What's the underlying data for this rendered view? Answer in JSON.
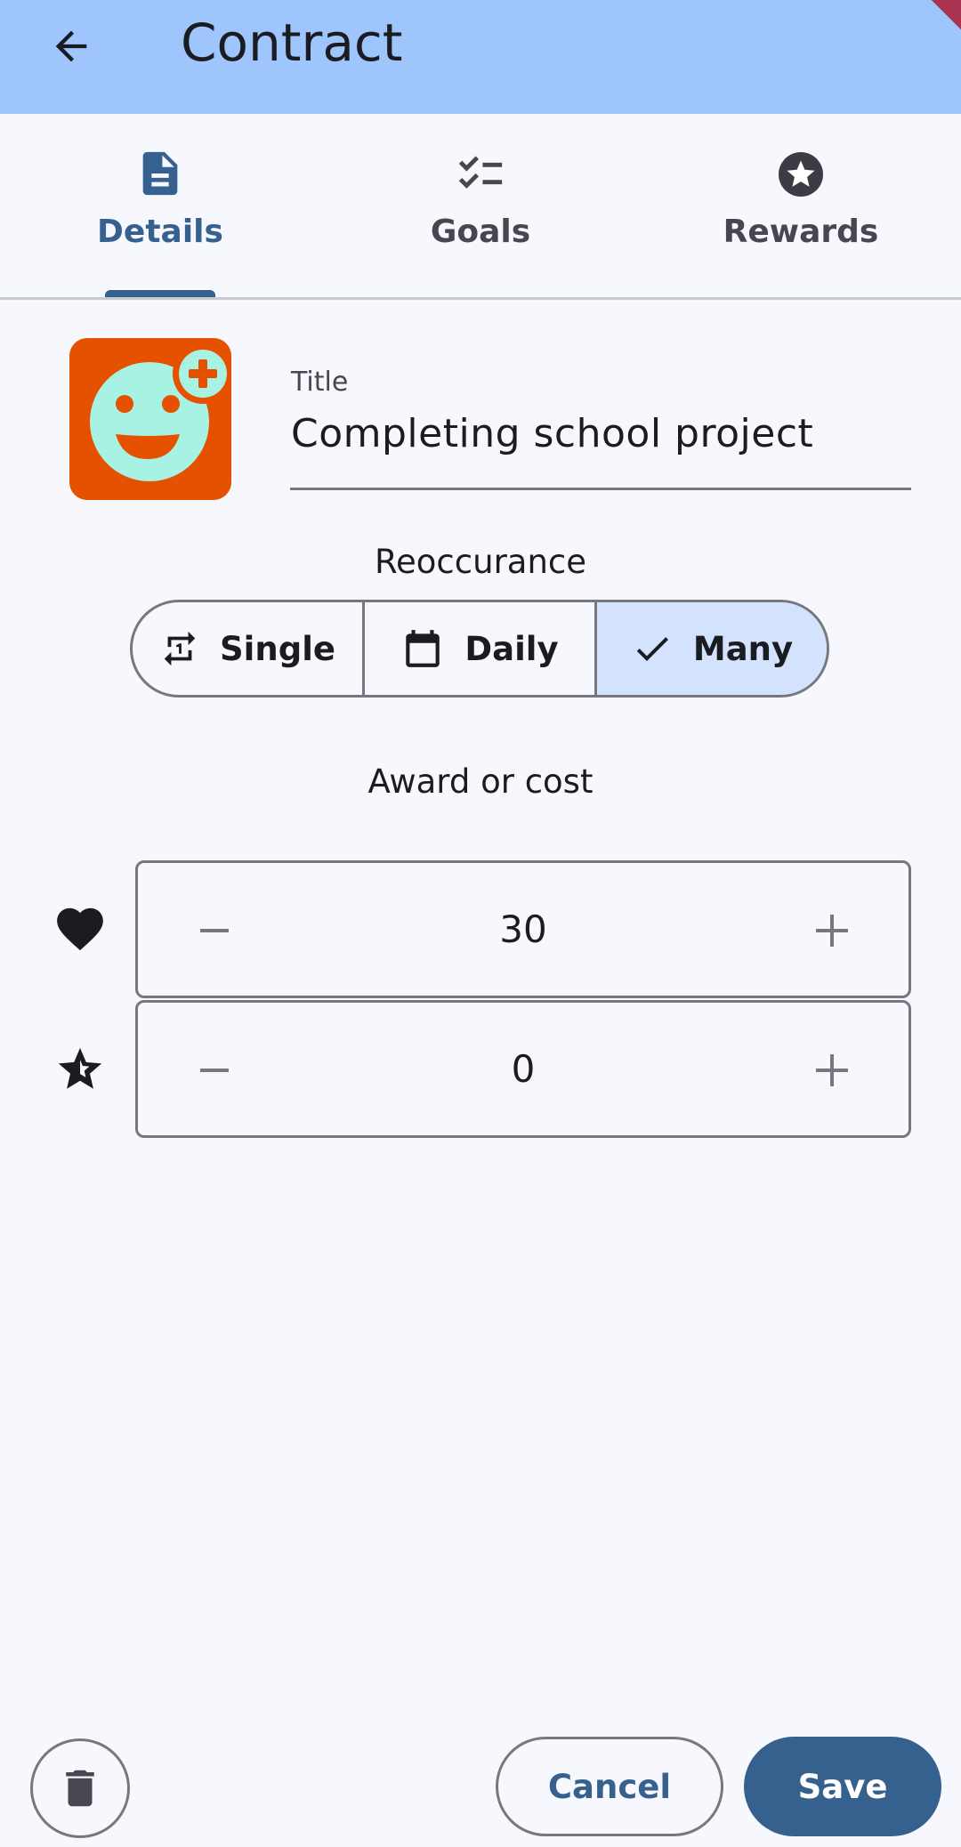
{
  "appbar": {
    "title": "Contract",
    "back_icon": "arrow-back-icon"
  },
  "tabs": [
    {
      "label": "Details",
      "icon": "description-icon",
      "active": true
    },
    {
      "label": "Goals",
      "icon": "checklist-icon",
      "active": false
    },
    {
      "label": "Rewards",
      "icon": "star-circle-icon",
      "active": false
    }
  ],
  "details": {
    "avatar_icon": "face-add-icon",
    "title_label": "Title",
    "title_value": "Completing school project",
    "reoccurance_label": "Reoccurance",
    "reoccurance_options": [
      {
        "label": "Single",
        "icon": "repeat-one-icon",
        "selected": false
      },
      {
        "label": "Daily",
        "icon": "calendar-icon",
        "selected": false
      },
      {
        "label": "Many",
        "icon": "check-icon",
        "selected": true
      }
    ],
    "award_label": "Award or cost",
    "steppers": [
      {
        "icon": "heart-icon",
        "value": "30"
      },
      {
        "icon": "star-outline-icon",
        "value": "0"
      }
    ]
  },
  "actions": {
    "delete_icon": "trash-icon",
    "cancel_label": "Cancel",
    "save_label": "Save"
  },
  "colors": {
    "appbar": "#9ec5fc",
    "primary": "#36618e",
    "avatar_bg": "#e65100",
    "avatar_face": "#a7f2e3",
    "selected_segment": "#d3e3fd"
  }
}
